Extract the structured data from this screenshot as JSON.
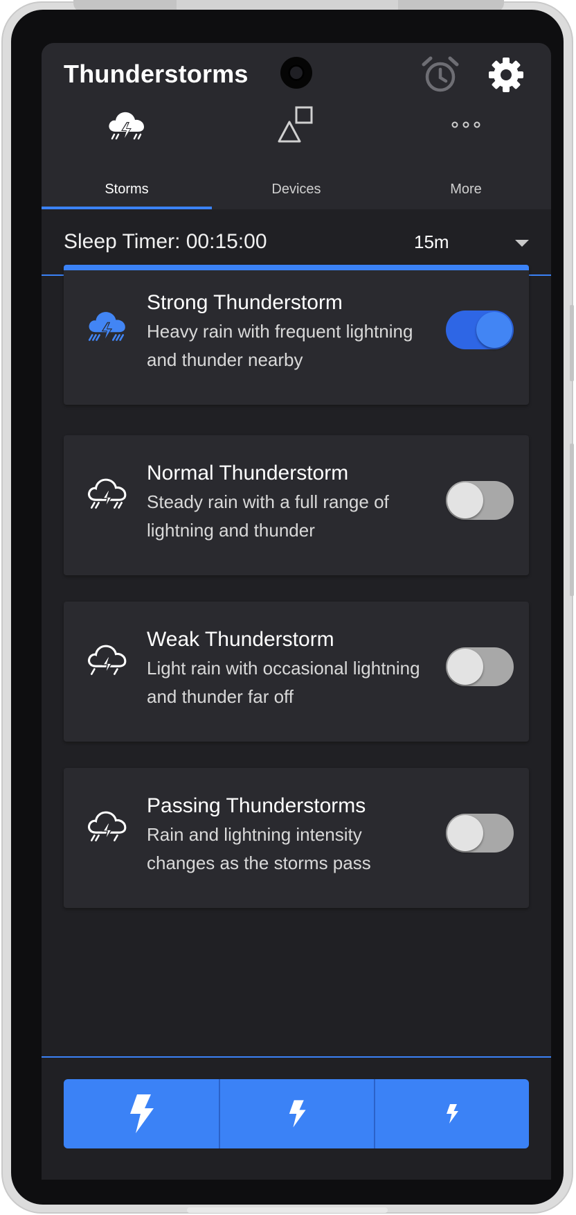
{
  "app": {
    "title": "Thunderstorms"
  },
  "header_icons": {
    "alarm": "alarm-clock-icon",
    "settings": "gear-icon"
  },
  "tabs": [
    {
      "label": "Storms",
      "icon": "storm-cloud-icon",
      "selected": true
    },
    {
      "label": "Devices",
      "icon": "shapes-icon",
      "selected": false
    },
    {
      "label": "More",
      "icon": "more-dots-icon",
      "selected": false
    }
  ],
  "sleep_timer": {
    "label": "Sleep Timer: 00:15:00",
    "selected_option": "15m"
  },
  "storms": [
    {
      "title": "Strong Thunderstorm",
      "description": "Heavy rain with frequent lightning and thunder nearby",
      "enabled": true
    },
    {
      "title": "Normal Thunderstorm",
      "description": "Steady rain with a full range of lightning and thunder",
      "enabled": false
    },
    {
      "title": "Weak Thunderstorm",
      "description": "Light rain with occasional lightning and thunder far off",
      "enabled": false
    },
    {
      "title": "Passing Thunderstorms",
      "description": "Rain and lightning intensity changes as the storms pass",
      "enabled": false
    }
  ],
  "bottom_controls": [
    {
      "icon": "lightning-bolt-large-icon"
    },
    {
      "icon": "lightning-bolt-medium-icon"
    },
    {
      "icon": "lightning-bolt-small-icon"
    }
  ],
  "colors": {
    "accent": "#3b82f6",
    "background": "#202024",
    "card": "#2a2a2f",
    "toggle_off": "#a8a8a8"
  }
}
